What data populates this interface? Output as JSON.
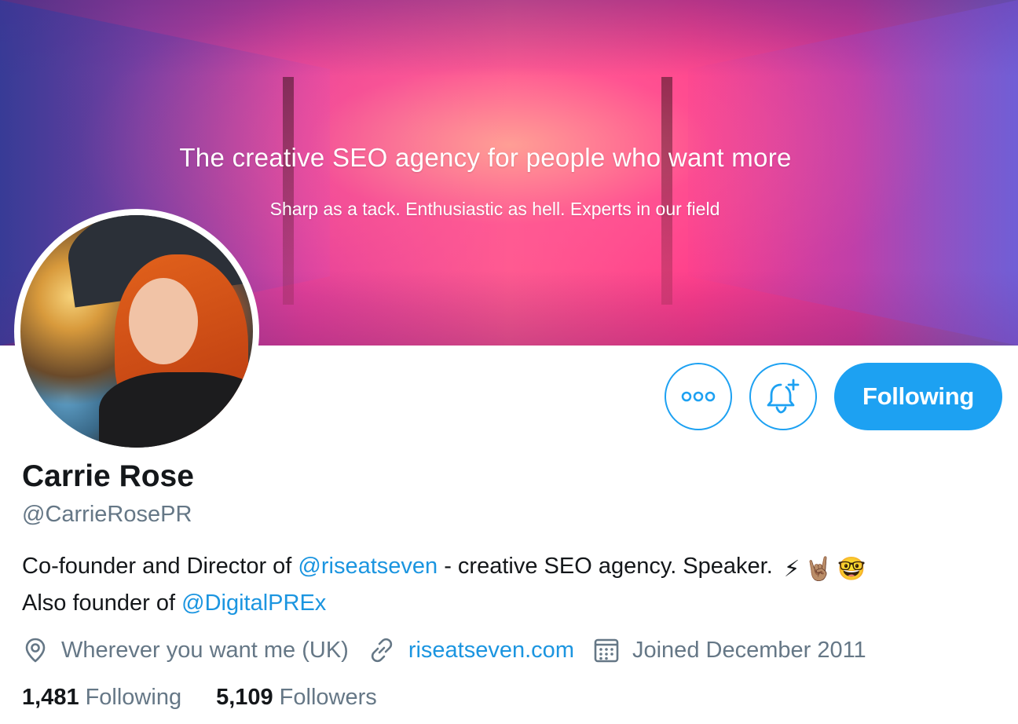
{
  "banner": {
    "headline": "The creative SEO agency for people who want more",
    "subline": "Sharp as a tack. Enthusiastic as hell. Experts in our field"
  },
  "actions": {
    "following_label": "Following"
  },
  "profile": {
    "name": "Carrie Rose",
    "handle": "@CarrieRosePR",
    "bio": {
      "part1": "Co-founder and Director of ",
      "mention1": "@riseatseven",
      "part2": " - creative SEO agency. Speaker. ",
      "emojis": [
        "⚡",
        "🤘🏽",
        "🤓"
      ],
      "part3": " Also founder of ",
      "mention2": "@DigitalPREx"
    },
    "location": "Wherever you want me (UK)",
    "website": "riseatseven.com",
    "joined": "Joined December 2011"
  },
  "stats": {
    "following_count": "1,481",
    "following_label": "Following",
    "followers_count": "5,109",
    "followers_label": "Followers"
  },
  "colors": {
    "accent": "#1da1f2",
    "link": "#1b95e0",
    "secondary_text": "#657786",
    "primary_text": "#14171a"
  },
  "icons": [
    "more-icon",
    "notification-bell-icon",
    "location-pin-icon",
    "link-icon",
    "calendar-icon"
  ]
}
